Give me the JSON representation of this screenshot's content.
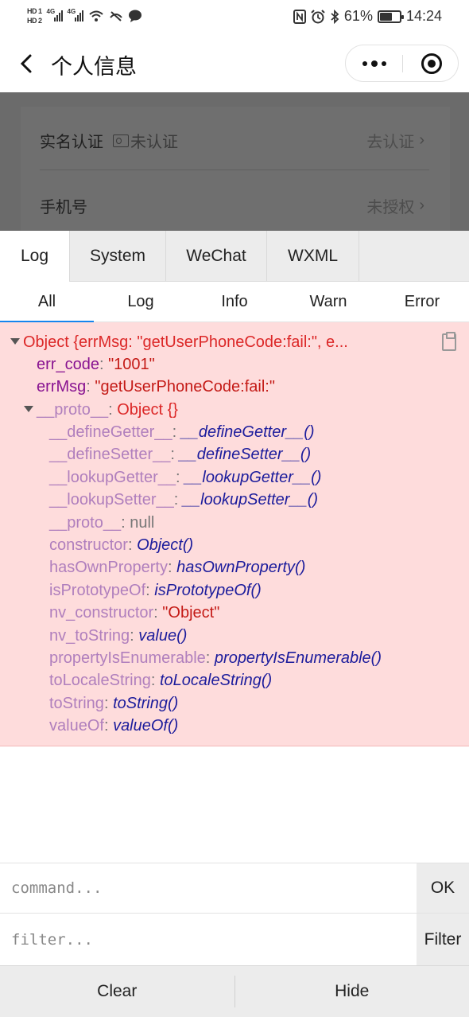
{
  "status_bar": {
    "hd1": "HD 1",
    "hd2": "HD 2",
    "net1": "4G",
    "net2": "4G",
    "battery_text": "61%",
    "battery_level": 0.61,
    "time": "14:24",
    "icons": [
      "signal-icon",
      "wifi-icon",
      "muted-icon",
      "chat-icon",
      "nfc-icon",
      "alarm-icon",
      "bluetooth-icon"
    ]
  },
  "nav": {
    "title": "个人信息"
  },
  "page": {
    "rows": [
      {
        "label": "实名认证",
        "badge": "未认证",
        "action": "去认证"
      },
      {
        "label": "手机号",
        "action": "未授权"
      }
    ]
  },
  "vconsole": {
    "tabs": [
      "Log",
      "System",
      "WeChat",
      "WXML"
    ],
    "active_tab": "Log",
    "subtabs": [
      "All",
      "Log",
      "Info",
      "Warn",
      "Error"
    ],
    "active_subtab": "All",
    "log": {
      "summary": "Object {errMsg: \"getUserPhoneCode:fail:\", e...",
      "err_code_key": "err_code",
      "err_code_val": "\"1001\"",
      "errmsg_key": "errMsg",
      "errmsg_val": "\"getUserPhoneCode:fail:\"",
      "proto_key": "__proto__",
      "proto_val": "Object {}",
      "proto_entries": [
        {
          "key": "__defineGetter__",
          "value": "__defineGetter__()",
          "kind": "fn"
        },
        {
          "key": "__defineSetter__",
          "value": "__defineSetter__()",
          "kind": "fn"
        },
        {
          "key": "__lookupGetter__",
          "value": "__lookupGetter__()",
          "kind": "fn"
        },
        {
          "key": "__lookupSetter__",
          "value": "__lookupSetter__()",
          "kind": "fn"
        },
        {
          "key": "__proto__",
          "value": "null",
          "kind": "null"
        },
        {
          "key": "constructor",
          "value": "Object()",
          "kind": "fn"
        },
        {
          "key": "hasOwnProperty",
          "value": "hasOwnProperty()",
          "kind": "fn"
        },
        {
          "key": "isPrototypeOf",
          "value": "isPrototypeOf()",
          "kind": "fn"
        },
        {
          "key": "nv_constructor",
          "value": "\"Object\"",
          "kind": "str"
        },
        {
          "key": "nv_toString",
          "value": "value()",
          "kind": "fn"
        },
        {
          "key": "propertyIsEnumerable",
          "value": "propertyIsEnumerable()",
          "kind": "fn"
        },
        {
          "key": "toLocaleString",
          "value": "toLocaleString()",
          "kind": "fn"
        },
        {
          "key": "toString",
          "value": "toString()",
          "kind": "fn"
        },
        {
          "key": "valueOf",
          "value": "valueOf()",
          "kind": "fn"
        }
      ]
    },
    "command_placeholder": "command...",
    "ok_label": "OK",
    "filter_placeholder": "filter...",
    "filter_label": "Filter",
    "clear_label": "Clear",
    "hide_label": "Hide"
  }
}
